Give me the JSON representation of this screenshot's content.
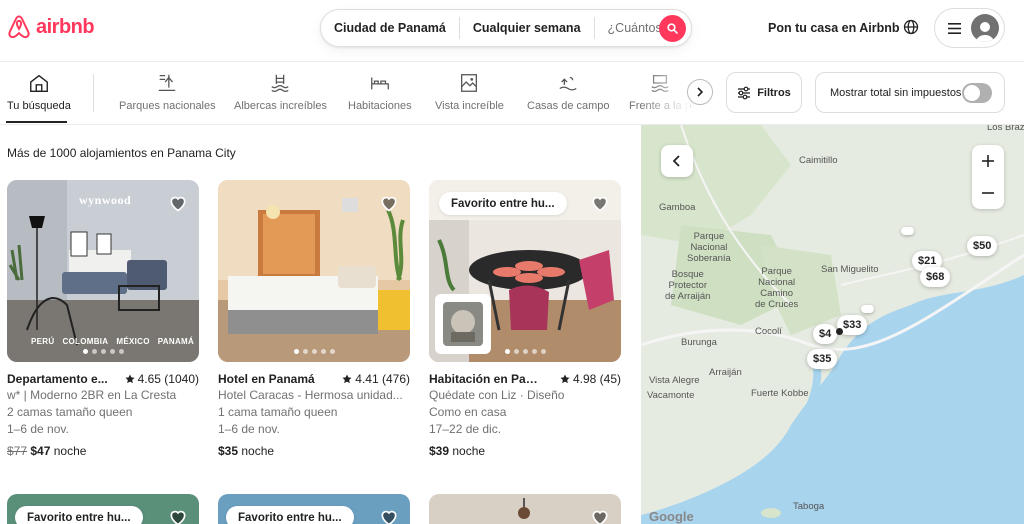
{
  "brand": {
    "name": "airbnb",
    "color": "#ff385c"
  },
  "search": {
    "location": "Ciudad de Panamá",
    "dates": "Cualquier semana",
    "guests_placeholder": "¿Cuántos?"
  },
  "header": {
    "host_link": "Pon tu casa en Airbnb"
  },
  "categories": [
    {
      "label": "Tu búsqueda",
      "icon": "home-search-icon",
      "active": true
    },
    {
      "label": "Parques nacionales",
      "icon": "national-park-icon"
    },
    {
      "label": "Albercas increíbles",
      "icon": "pool-icon"
    },
    {
      "label": "Habitaciones",
      "icon": "bed-icon"
    },
    {
      "label": "Vista increíble",
      "icon": "view-icon"
    },
    {
      "label": "Casas de campo",
      "icon": "countryside-icon"
    },
    {
      "label": "Frente a la p",
      "icon": "beach-icon"
    }
  ],
  "filters": {
    "label": "Filtros",
    "taxes_label": "Mostrar total sin impuestos",
    "taxes_on": false
  },
  "results_count": "Más de 1000 alojamientos en Panama City",
  "listings": [
    {
      "title": "Departamento e...",
      "rating": "4.65 (1040)",
      "line1": "w* | Moderno 2BR en La Cresta",
      "line2": "2 camas tamaño queen",
      "dates": "1–6 de nov.",
      "price_old": "$77",
      "price": "$47",
      "price_unit": "noche",
      "badge": "",
      "image_overlay": "wynwood",
      "image_caption": [
        "PERÚ",
        "COLOMBIA",
        "MÉXICO",
        "PANAMÁ"
      ]
    },
    {
      "title": "Hotel en Panamá",
      "rating": "4.41 (476)",
      "line1": "Hotel Caracas - Hermosa unidad...",
      "line2": "1 cama tamaño queen",
      "dates": "1–6 de nov.",
      "price_old": "",
      "price": "$35",
      "price_unit": "noche",
      "badge": ""
    },
    {
      "title": "Habitación en Pana...",
      "rating": "4.98 (45)",
      "line1": "Quédate con Liz · Diseño",
      "line2": "Como en casa",
      "dates": "17–22 de dic.",
      "price_old": "",
      "price": "$39",
      "price_unit": "noche",
      "badge": "Favorito entre hu..."
    }
  ],
  "second_row_badges": [
    "Favorito entre hu...",
    "Favorito entre hu..."
  ],
  "map": {
    "labels": {
      "los_brazos": "Los Braz",
      "caimitillo": "Caimitillo",
      "gamboa": "Gamboa",
      "parque_soberania": "Parque\nNacional\nSoberanía",
      "bosque_arraijan": "Bosque\nProtector\nde Arraiján",
      "parque_cruces": "Parque\nNacional\nCamino\nde Cruces",
      "san_miguelito": "San Miguelito",
      "cocoli": "Cocolí",
      "burunga": "Burunga",
      "arraijan": "Arraiján",
      "vista_alegre": "Vista Alegre",
      "vacamonte": "Vacamonte",
      "fuerte_kobbe": "Fuerte Kobbe",
      "taboga": "Taboga"
    },
    "pins": [
      "$50",
      "$21",
      "$68",
      "$33",
      "$4",
      "$35"
    ],
    "attribution": "Google"
  }
}
